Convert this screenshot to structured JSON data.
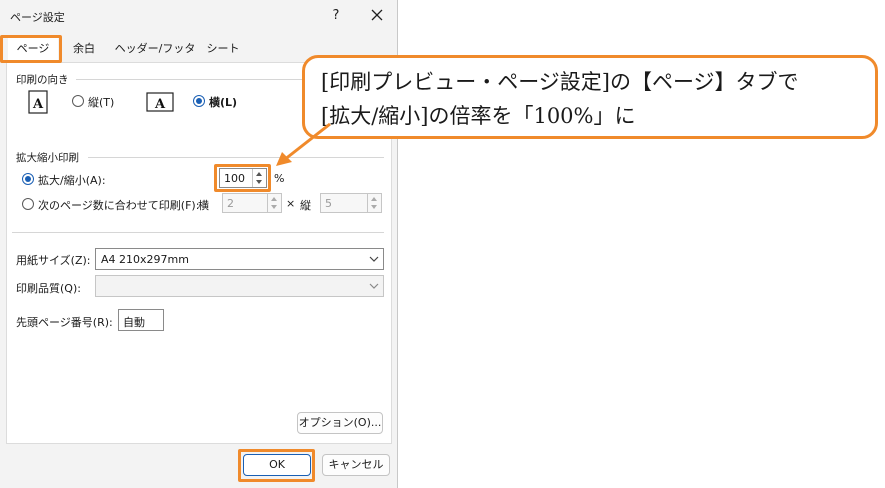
{
  "dialog": {
    "title": "ページ設定",
    "help_label": "?"
  },
  "tabs": [
    {
      "label": "ページ",
      "active": true
    },
    {
      "label": "余白",
      "active": false
    },
    {
      "label": "ヘッダー/フッター",
      "active": false
    },
    {
      "label": "シート",
      "active": false
    }
  ],
  "orientation": {
    "section_label": "印刷の向き",
    "portrait_label": "縦(T)",
    "landscape_label": "横(L)",
    "selected": "landscape"
  },
  "scaling": {
    "section_label": "拡大縮小印刷",
    "scale_label": "拡大/縮小(A):",
    "scale_value": "100",
    "percent_sign": "%",
    "fit_label": "次のページ数に合わせて印刷(F):",
    "wide_label": "横",
    "wide_value": "2",
    "times_sign": "×",
    "tall_label": "縦",
    "tall_value": "5"
  },
  "paper_size": {
    "label": "用紙サイズ(Z):",
    "value": "A4 210x297mm"
  },
  "print_quality": {
    "label": "印刷品質(Q):",
    "value": ""
  },
  "first_page": {
    "label": "先頭ページ番号(R):",
    "value": "自動"
  },
  "buttons": {
    "options": "オプション(O)...",
    "ok": "OK",
    "cancel": "キャンセル"
  },
  "callout": {
    "line1": "[印刷プレビュー・ページ設定]の【ページ】タブで",
    "line2": "[拡大/縮小]の倍率を「100%」に"
  },
  "colors": {
    "highlight": "#f08a2b",
    "accent": "#1a5fb4",
    "dialog_bg": "#f3f3f3"
  }
}
